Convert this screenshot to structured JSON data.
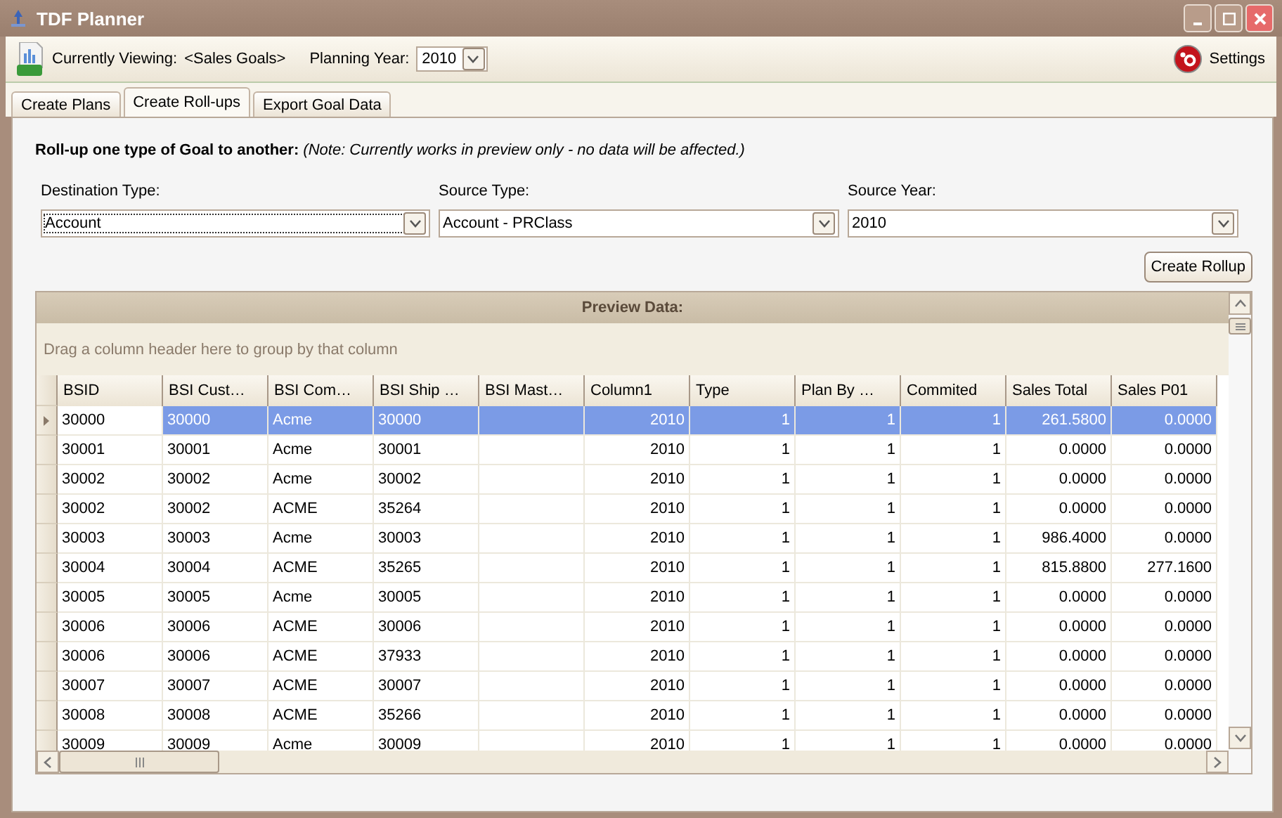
{
  "window": {
    "title": "TDF Planner"
  },
  "toolbar": {
    "viewing_label": "Currently Viewing:",
    "viewing_value": "<Sales Goals>",
    "year_label": "Planning Year:",
    "year_value": "2010",
    "settings": "Settings"
  },
  "tabs": [
    {
      "label": "Create Plans",
      "selected": false
    },
    {
      "label": "Create Roll-ups",
      "selected": true
    },
    {
      "label": "Export Goal Data",
      "selected": false
    }
  ],
  "heading": {
    "title": "Roll-up one type of Goal to another:",
    "note": "(Note: Currently works in preview only - no data will be affected.)"
  },
  "fields": [
    {
      "label": "Destination Type:",
      "value": "Account",
      "focused": true
    },
    {
      "label": "Source Type:",
      "value": "Account - PRClass",
      "focused": false
    },
    {
      "label": "Source Year:",
      "value": "2010",
      "focused": false
    }
  ],
  "create_button": "Create Rollup",
  "grid": {
    "title": "Preview Data:",
    "group_hint": "Drag a column header here to group by that column",
    "columns": [
      {
        "label": "BSID",
        "numeric": false
      },
      {
        "label": "BSI Cust…",
        "numeric": false
      },
      {
        "label": "BSI Com…",
        "numeric": false
      },
      {
        "label": "BSI Ship …",
        "numeric": false
      },
      {
        "label": "BSI Mast…",
        "numeric": false
      },
      {
        "label": "Column1",
        "numeric": true
      },
      {
        "label": "Type",
        "numeric": true
      },
      {
        "label": "Plan By …",
        "numeric": true
      },
      {
        "label": "Commited",
        "numeric": true
      },
      {
        "label": "Sales Total",
        "numeric": true
      },
      {
        "label": "Sales P01",
        "numeric": true
      }
    ],
    "rows": [
      {
        "selected": true,
        "cells": [
          "30000",
          "30000",
          "Acme",
          "30000",
          "",
          "2010",
          "1",
          "1",
          "1",
          "261.5800",
          "0.0000"
        ]
      },
      {
        "selected": false,
        "cells": [
          "30001",
          "30001",
          "Acme",
          "30001",
          "",
          "2010",
          "1",
          "1",
          "1",
          "0.0000",
          "0.0000"
        ]
      },
      {
        "selected": false,
        "cells": [
          "30002",
          "30002",
          "Acme",
          "30002",
          "",
          "2010",
          "1",
          "1",
          "1",
          "0.0000",
          "0.0000"
        ]
      },
      {
        "selected": false,
        "cells": [
          "30002",
          "30002",
          "ACME",
          "35264",
          "",
          "2010",
          "1",
          "1",
          "1",
          "0.0000",
          "0.0000"
        ]
      },
      {
        "selected": false,
        "cells": [
          "30003",
          "30003",
          "Acme",
          "30003",
          "",
          "2010",
          "1",
          "1",
          "1",
          "986.4000",
          "0.0000"
        ]
      },
      {
        "selected": false,
        "cells": [
          "30004",
          "30004",
          "ACME",
          "35265",
          "",
          "2010",
          "1",
          "1",
          "1",
          "815.8800",
          "277.1600"
        ]
      },
      {
        "selected": false,
        "cells": [
          "30005",
          "30005",
          "Acme",
          "30005",
          "",
          "2010",
          "1",
          "1",
          "1",
          "0.0000",
          "0.0000"
        ]
      },
      {
        "selected": false,
        "cells": [
          "30006",
          "30006",
          "ACME",
          "30006",
          "",
          "2010",
          "1",
          "1",
          "1",
          "0.0000",
          "0.0000"
        ]
      },
      {
        "selected": false,
        "cells": [
          "30006",
          "30006",
          "ACME",
          "37933",
          "",
          "2010",
          "1",
          "1",
          "1",
          "0.0000",
          "0.0000"
        ]
      },
      {
        "selected": false,
        "cells": [
          "30007",
          "30007",
          "ACME",
          "30007",
          "",
          "2010",
          "1",
          "1",
          "1",
          "0.0000",
          "0.0000"
        ]
      },
      {
        "selected": false,
        "cells": [
          "30008",
          "30008",
          "ACME",
          "35266",
          "",
          "2010",
          "1",
          "1",
          "1",
          "0.0000",
          "0.0000"
        ]
      },
      {
        "selected": false,
        "cells": [
          "30009",
          "30009",
          "Acme",
          "30009",
          "",
          "2010",
          "1",
          "1",
          "1",
          "0.0000",
          "0.0000"
        ]
      }
    ]
  }
}
